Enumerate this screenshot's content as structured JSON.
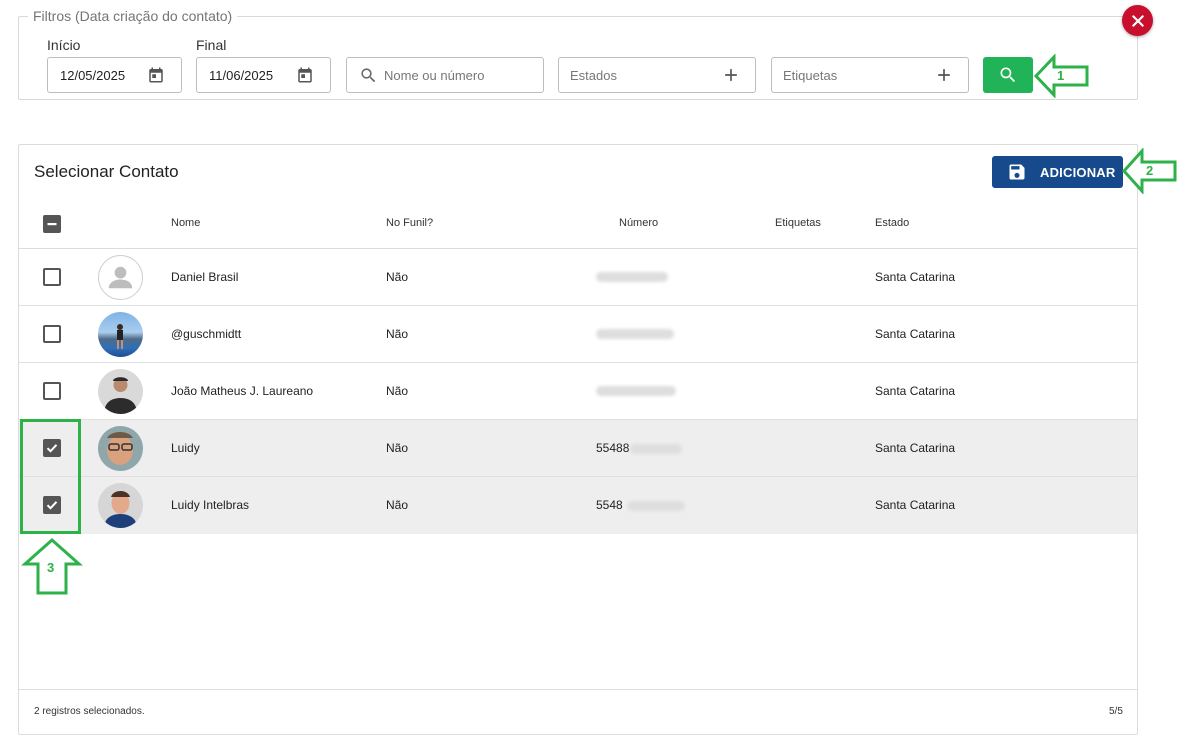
{
  "filters": {
    "legend": "Filtros (Data criação do contato)",
    "start_label": "Início",
    "start_value": "12/05/2025",
    "end_label": "Final",
    "end_value": "11/06/2025",
    "search_placeholder": "Nome ou número",
    "states_placeholder": "Estados",
    "tags_placeholder": "Etiquetas"
  },
  "panel": {
    "title": "Selecionar Contato",
    "add_button": "ADICIONAR"
  },
  "table": {
    "columns": {
      "name": "Nome",
      "funnel": "No Funil?",
      "number": "Número",
      "tags": "Etiquetas",
      "state": "Estado"
    },
    "rows": [
      {
        "name": "Daniel Brasil",
        "funnel": "Não",
        "number_prefix": "",
        "state": "Santa Catarina",
        "selected": false
      },
      {
        "name": "@guschmidtt",
        "funnel": "Não",
        "number_prefix": "",
        "state": "Santa Catarina",
        "selected": false
      },
      {
        "name": "João Matheus J. Laureano",
        "funnel": "Não",
        "number_prefix": "",
        "state": "Santa Catarina",
        "selected": false
      },
      {
        "name": "Luidy",
        "funnel": "Não",
        "number_prefix": "55488",
        "state": "Santa Catarina",
        "selected": true
      },
      {
        "name": "Luidy Intelbras",
        "funnel": "Não",
        "number_prefix": "5548",
        "state": "Santa Catarina",
        "selected": true
      }
    ]
  },
  "footer": {
    "selection_text": "2 registros selecionados.",
    "count": "5/5"
  },
  "annotations": {
    "one": "1",
    "two": "2",
    "three": "3"
  },
  "colors": {
    "search_green": "#20b358",
    "add_blue": "#164a8c",
    "close_red": "#c8102e",
    "annotation_green": "#2db24a"
  },
  "icons": [
    "calendar-icon",
    "search-icon",
    "plus-icon",
    "close-icon",
    "save-icon",
    "person-icon"
  ]
}
